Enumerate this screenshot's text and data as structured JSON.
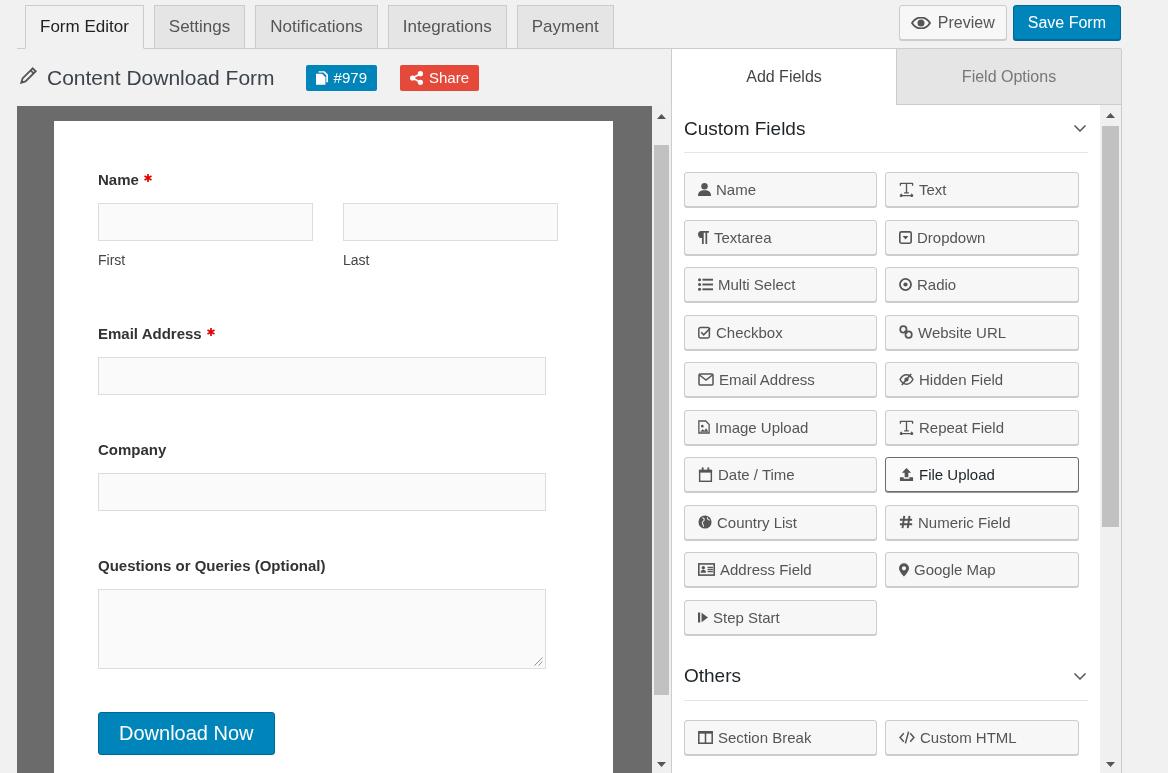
{
  "tabs": [
    {
      "label": "Form Editor",
      "selected": true
    },
    {
      "label": "Settings",
      "selected": false
    },
    {
      "label": "Notifications",
      "selected": false
    },
    {
      "label": "Integrations",
      "selected": false
    },
    {
      "label": "Payment",
      "selected": false
    }
  ],
  "actions": {
    "preview_button": "Preview",
    "save_button": "Save Form"
  },
  "form_header": {
    "title": "Content Download Form",
    "id_button": "#979",
    "share_button": "Share"
  },
  "form_preview": {
    "fields": [
      {
        "kind": "name",
        "label": "Name",
        "required": true,
        "sublabels": [
          "First",
          "Last"
        ]
      },
      {
        "kind": "text",
        "label": "Email Address",
        "required": true
      },
      {
        "kind": "text",
        "label": "Company",
        "required": false
      },
      {
        "kind": "textarea",
        "label": "Questions or Queries (Optional)",
        "required": false
      }
    ],
    "submit_button": "Download Now"
  },
  "panel": {
    "tabs": [
      {
        "label": "Add Fields",
        "selected": true
      },
      {
        "label": "Field Options",
        "selected": false
      }
    ],
    "sections": [
      {
        "title": "Custom Fields",
        "expanded": true,
        "buttons": [
          {
            "kind": "name",
            "label": "Name",
            "hovered": false
          },
          {
            "kind": "text",
            "label": "Text",
            "hovered": false
          },
          {
            "kind": "textarea",
            "label": "Textarea",
            "hovered": false
          },
          {
            "kind": "dropdown",
            "label": "Dropdown",
            "hovered": false
          },
          {
            "kind": "multi_select",
            "label": "Multi Select",
            "hovered": false
          },
          {
            "kind": "radio",
            "label": "Radio",
            "hovered": false
          },
          {
            "kind": "checkbox",
            "label": "Checkbox",
            "hovered": false
          },
          {
            "kind": "url",
            "label": "Website URL",
            "hovered": false
          },
          {
            "kind": "email",
            "label": "Email Address",
            "hovered": false
          },
          {
            "kind": "hidden",
            "label": "Hidden Field",
            "hovered": false
          },
          {
            "kind": "image_upload",
            "label": "Image Upload",
            "hovered": false
          },
          {
            "kind": "repeat",
            "label": "Repeat Field",
            "hovered": false
          },
          {
            "kind": "date_time",
            "label": "Date / Time",
            "hovered": false
          },
          {
            "kind": "file_upload",
            "label": "File Upload",
            "hovered": true
          },
          {
            "kind": "country",
            "label": "Country List",
            "hovered": false
          },
          {
            "kind": "number",
            "label": "Numeric Field",
            "hovered": false
          },
          {
            "kind": "address",
            "label": "Address Field",
            "hovered": false
          },
          {
            "kind": "map",
            "label": "Google Map",
            "hovered": false
          },
          {
            "kind": "step",
            "label": "Step Start",
            "hovered": false
          }
        ]
      },
      {
        "title": "Others",
        "expanded": true,
        "buttons": [
          {
            "kind": "section_break",
            "label": "Section Break",
            "hovered": false
          },
          {
            "kind": "html",
            "label": "Custom HTML",
            "hovered": false
          }
        ]
      }
    ]
  }
}
